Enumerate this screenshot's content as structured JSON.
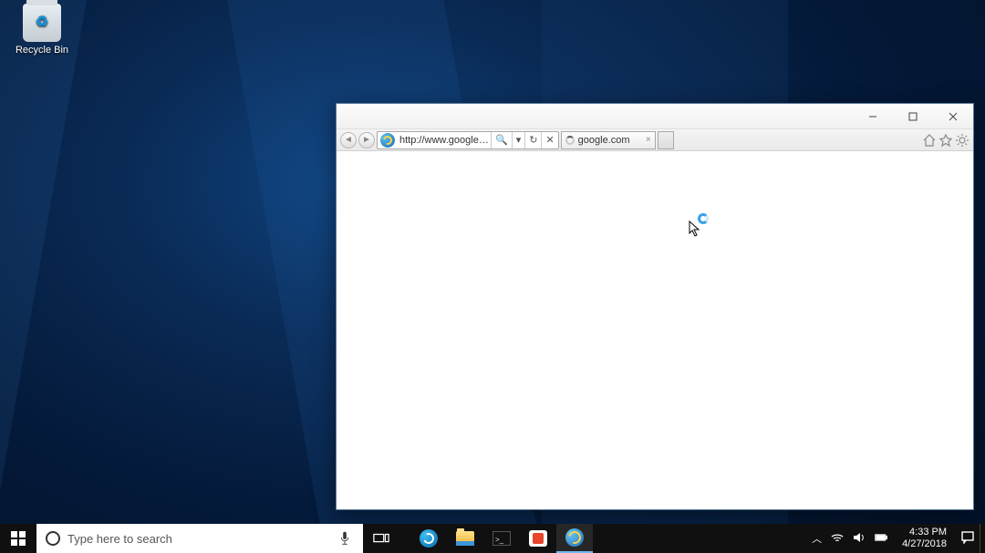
{
  "desktop": {
    "recycle_bin_label": "Recycle Bin"
  },
  "ie": {
    "url": "http://www.google....",
    "search_glyph": "🔍",
    "dropdown_glyph": "▾",
    "refresh_glyph": "↻",
    "stop_glyph": "✕",
    "tab_title": "google.com",
    "tab_close": "×"
  },
  "taskbar": {
    "search_placeholder": "Type here to search",
    "time": "4:33 PM",
    "date": "4/27/2018",
    "tray_up": "︿"
  }
}
